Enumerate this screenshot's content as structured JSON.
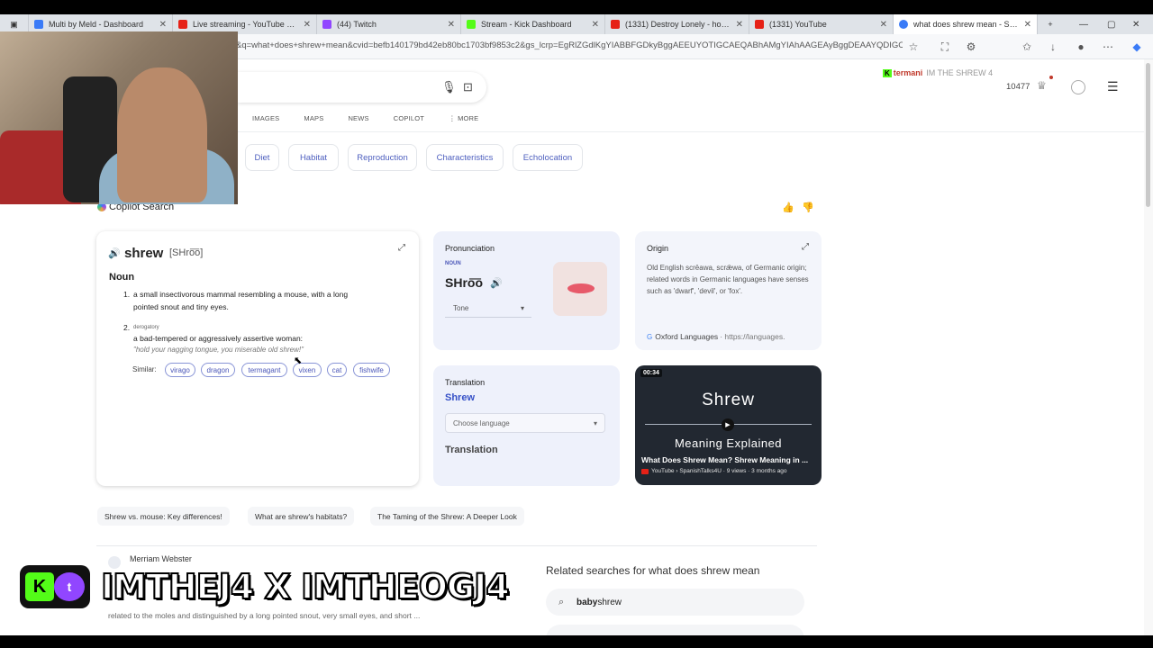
{
  "browser": {
    "tabs": [
      {
        "label": "Multi by Meld - Dashboard",
        "color": "#3a7bf7",
        "active": false
      },
      {
        "label": "Live streaming - YouTube Studio",
        "color": "#e62117",
        "active": false
      },
      {
        "label": "(44) Twitch",
        "color": "#9146ff",
        "active": false
      },
      {
        "label": "Stream - Kick Dashboard",
        "color": "#53fc18",
        "active": false
      },
      {
        "label": "(1331) Destroy Lonely - how u fe",
        "color": "#e62117",
        "active": false
      },
      {
        "label": "(1331) YouTube",
        "color": "#e62117",
        "active": false
      },
      {
        "label": "what does shrew mean - Search",
        "color": "#3a7bf7",
        "active": true
      }
    ],
    "url": "&q=what+does+shrew+mean&cvid=befb140179bd42eb80bc1703bf9853c2&gs_lcrp=EgRlZGdlKgYIABBFGDkyBggAEEUYOTIGCAEQABhAMgYIAhAAGEAyBggDEAAYQDIGCAQQ..."
  },
  "header": {
    "nav_tabs": [
      "IMAGES",
      "MAPS",
      "NEWS",
      "COPILOT",
      "MORE"
    ],
    "brand_overlay": {
      "kick": "K",
      "name": "termani",
      "tag": "IM THE SHREW 4"
    },
    "rewards": "10477"
  },
  "chips": [
    "Diet",
    "Habitat",
    "Reproduction",
    "Characteristics",
    "Echolocation"
  ],
  "copilot": {
    "title": "Copilot Search"
  },
  "definition": {
    "word": "shrew",
    "phonetic": "[SHro͞o]",
    "pos": "Noun",
    "sense1_num": "1.",
    "sense1_line1": "a small insectivorous mammal resembling a mouse, with a long",
    "sense1_line2": "pointed snout and tiny eyes.",
    "sense2_num": "2.",
    "sense2_tag": "derogatory",
    "sense2_text": "a bad-tempered or aggressively assertive woman:",
    "sense2_example": "\"hold your nagging tongue, you miserable old shrew!\"",
    "similar_label": "Similar:",
    "similar": [
      "virago",
      "dragon",
      "termagant",
      "vixen",
      "cat",
      "fishwife"
    ]
  },
  "pronunciation": {
    "label": "Pronunciation",
    "pos": "NOUN",
    "text": "SHro͞o",
    "tone": "Tone"
  },
  "origin": {
    "label": "Origin",
    "text": "Old English scrēawa, scrǣwa, of Germanic origin; related words in Germanic languages have senses such as 'dwarf', 'devil', or 'fox'.",
    "source": "Oxford Languages",
    "source_url": "· https://languages."
  },
  "translation": {
    "label": "Translation",
    "word": "Shrew",
    "select": "Choose language",
    "output": "Translation"
  },
  "video": {
    "time": "00:34",
    "title": "Shrew",
    "subtitle": "Meaning Explained",
    "caption": "What Does Shrew Mean? Shrew Meaning in ...",
    "meta": "YouTube › SpanishTalks4U · 9 views · 3 months ago"
  },
  "followups": [
    "Shrew vs. mouse: Key differences!",
    "What are shrew's habitats?",
    "The Taming of the Shrew: A Deeper Look"
  ],
  "result": {
    "source": "Merriam Webster",
    "snippet": "related to the moles and distinguished by a long pointed snout, very small eyes, and short ..."
  },
  "related": {
    "title": "Related searches for what does shrew mean",
    "item1_bold": "baby",
    "item1_rest": " shrew"
  },
  "stream_banner": {
    "text": "IMTHEJ4 X IMTHEOGJ4",
    "kick": "K",
    "twitch": "t"
  }
}
